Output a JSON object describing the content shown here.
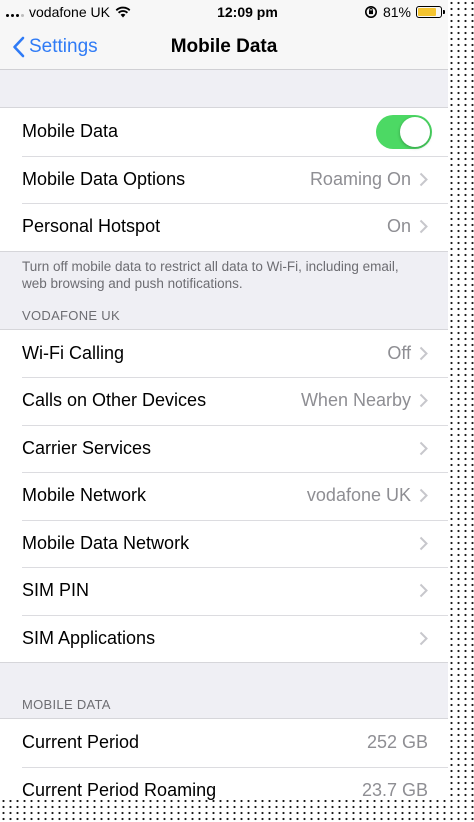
{
  "status_bar": {
    "carrier": "vodafone UK",
    "time": "12:09 pm",
    "battery": "81%"
  },
  "nav": {
    "back_label": "Settings",
    "title": "Mobile Data"
  },
  "group1": [
    {
      "label": "Mobile Data",
      "toggle": true
    },
    {
      "label": "Mobile Data Options",
      "value": "Roaming On"
    },
    {
      "label": "Personal Hotspot",
      "value": "On"
    }
  ],
  "group1_footer": "Turn off mobile data to restrict all data to Wi-Fi, including email, web browsing and push notifications.",
  "section_vodafone": "VODAFONE UK",
  "group2": [
    {
      "label": "Wi-Fi Calling",
      "value": "Off"
    },
    {
      "label": "Calls on Other Devices",
      "value": "When Nearby"
    },
    {
      "label": "Carrier Services",
      "value": ""
    },
    {
      "label": "Mobile Network",
      "value": "vodafone UK"
    },
    {
      "label": "Mobile Data Network",
      "value": ""
    },
    {
      "label": "SIM PIN",
      "value": ""
    },
    {
      "label": "SIM Applications",
      "value": ""
    }
  ],
  "section_mobile_data": "MOBILE DATA",
  "group3": [
    {
      "label": "Current Period",
      "value": "252 GB"
    },
    {
      "label": "Current Period Roaming",
      "value": "23.7 GB"
    }
  ],
  "colors": {
    "accent": "#2f7bf6",
    "toggle_on": "#4cd964",
    "battery": "#f4c430"
  }
}
